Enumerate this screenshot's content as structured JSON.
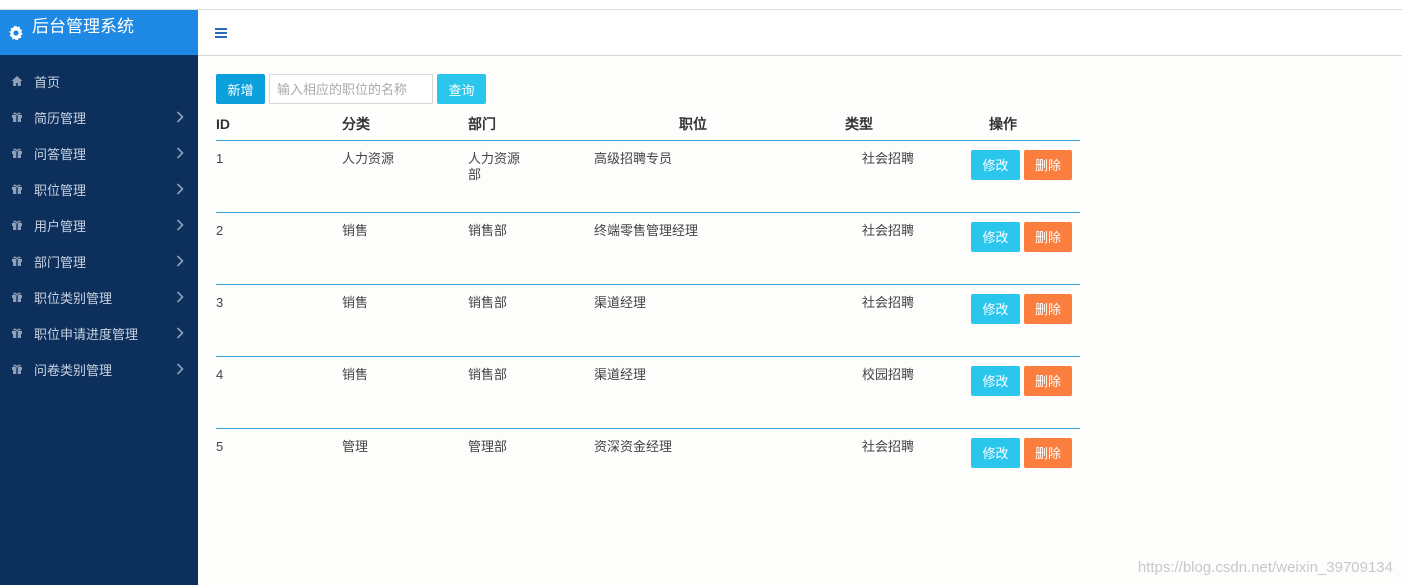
{
  "app": {
    "title": "后台管理系统"
  },
  "sidebar": {
    "items": [
      {
        "label": "首页",
        "icon": "home-icon",
        "has_arrow": false
      },
      {
        "label": "简历管理",
        "icon": "gift-icon",
        "has_arrow": true
      },
      {
        "label": "问答管理",
        "icon": "gift-icon",
        "has_arrow": true
      },
      {
        "label": "职位管理",
        "icon": "gift-icon",
        "has_arrow": true
      },
      {
        "label": "用户管理",
        "icon": "gift-icon",
        "has_arrow": true
      },
      {
        "label": "部门管理",
        "icon": "gift-icon",
        "has_arrow": true
      },
      {
        "label": "职位类别管理",
        "icon": "gift-icon",
        "has_arrow": true
      },
      {
        "label": "职位申请进度管理",
        "icon": "gift-icon",
        "has_arrow": true
      },
      {
        "label": "问卷类别管理",
        "icon": "gift-icon",
        "has_arrow": true
      }
    ]
  },
  "toolbar": {
    "add_label": "新增",
    "search_placeholder": "输入相应的职位的名称",
    "search_value": "",
    "query_label": "查询"
  },
  "table": {
    "headers": {
      "id": "ID",
      "category": "分类",
      "department": "部门",
      "position": "职位",
      "type": "类型",
      "ops": "操作"
    },
    "edit_label": "修改",
    "delete_label": "删除",
    "rows": [
      {
        "id": "1",
        "category": "人力资源",
        "department": "人力资源部",
        "position": "高级招聘专员",
        "type": "社会招聘"
      },
      {
        "id": "2",
        "category": "销售",
        "department": "销售部",
        "position": "终端零售管理经理",
        "type": "社会招聘"
      },
      {
        "id": "3",
        "category": "销售",
        "department": "销售部",
        "position": "渠道经理",
        "type": "社会招聘"
      },
      {
        "id": "4",
        "category": "销售",
        "department": "销售部",
        "position": "渠道经理",
        "type": "校园招聘"
      },
      {
        "id": "5",
        "category": "管理",
        "department": "管理部",
        "position": "资深资金经理",
        "type": "社会招聘"
      }
    ]
  },
  "watermark": "https://blog.csdn.net/weixin_39709134",
  "colors": {
    "sidebar_bg": "#0c2f5c",
    "brand_bg": "#1e88e5",
    "add_button": "#0b9fdc",
    "query_button": "#2bc6ec",
    "edit_button": "#2bc6ec",
    "delete_button": "#fb7e3f",
    "row_divider": "#3aa4d8"
  }
}
